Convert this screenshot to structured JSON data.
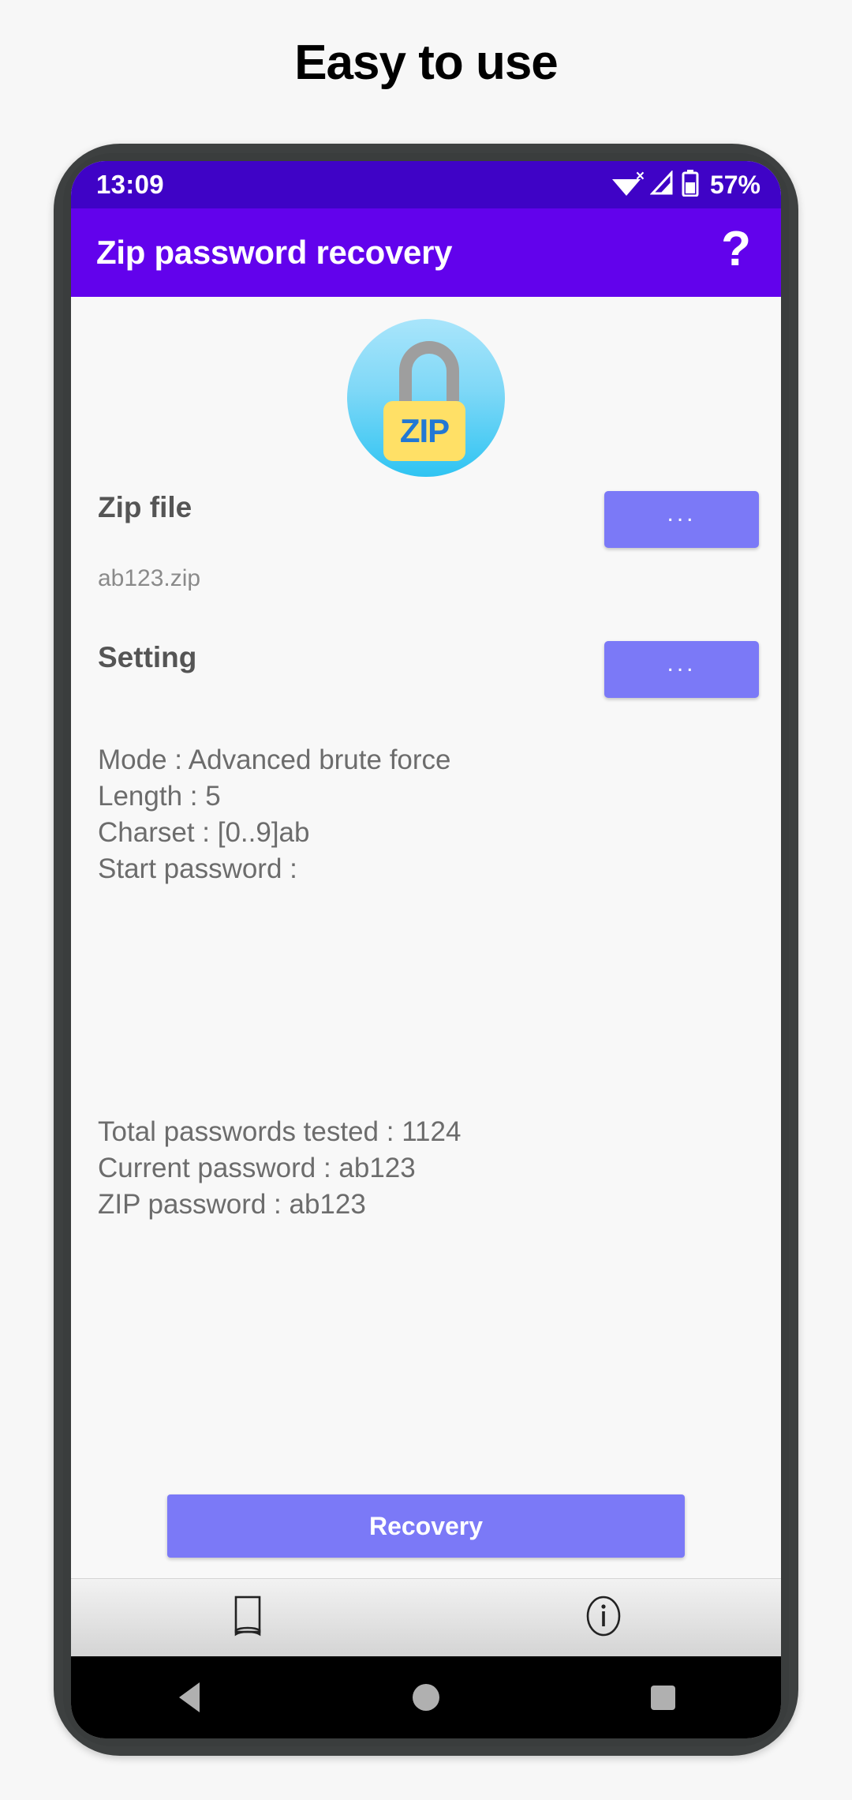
{
  "headline": "Easy to use",
  "status_bar": {
    "time": "13:09",
    "wifi_icon": "wifi-icon",
    "wifi_disconnected_mark": "×",
    "cellular_icon": "cellular-signal-icon",
    "battery_icon": "battery-icon",
    "battery_percent": "57%"
  },
  "app_bar": {
    "title": "Zip password recovery",
    "help_label": "?"
  },
  "logo": {
    "zip_text": "ZIP",
    "alt": "zip-unlock-logo"
  },
  "zip_file": {
    "label": "Zip file",
    "browse_label": "...",
    "file_name": "ab123.zip"
  },
  "setting": {
    "label": "Setting",
    "browse_label": "..."
  },
  "settings_summary": [
    "Mode : Advanced brute force",
    "Length : 5",
    "Charset : [0..9]ab",
    "Start password :"
  ],
  "results": [
    "Total passwords tested : 1124",
    "Current password : ab123",
    "ZIP password : ab123"
  ],
  "actions": {
    "recovery_label": "Recovery"
  },
  "bottom_bar": {
    "items": [
      {
        "icon": "book-icon",
        "name": "manual"
      },
      {
        "icon": "info-icon",
        "name": "about"
      }
    ]
  },
  "android_nav": {
    "back": "back-icon",
    "home": "home-icon",
    "recents": "recents-icon"
  },
  "colors": {
    "status_bar": "#3f03c6",
    "app_bar": "#6202ec",
    "accent_button": "#7b79f7",
    "page_bg": "#f7f7f7"
  }
}
